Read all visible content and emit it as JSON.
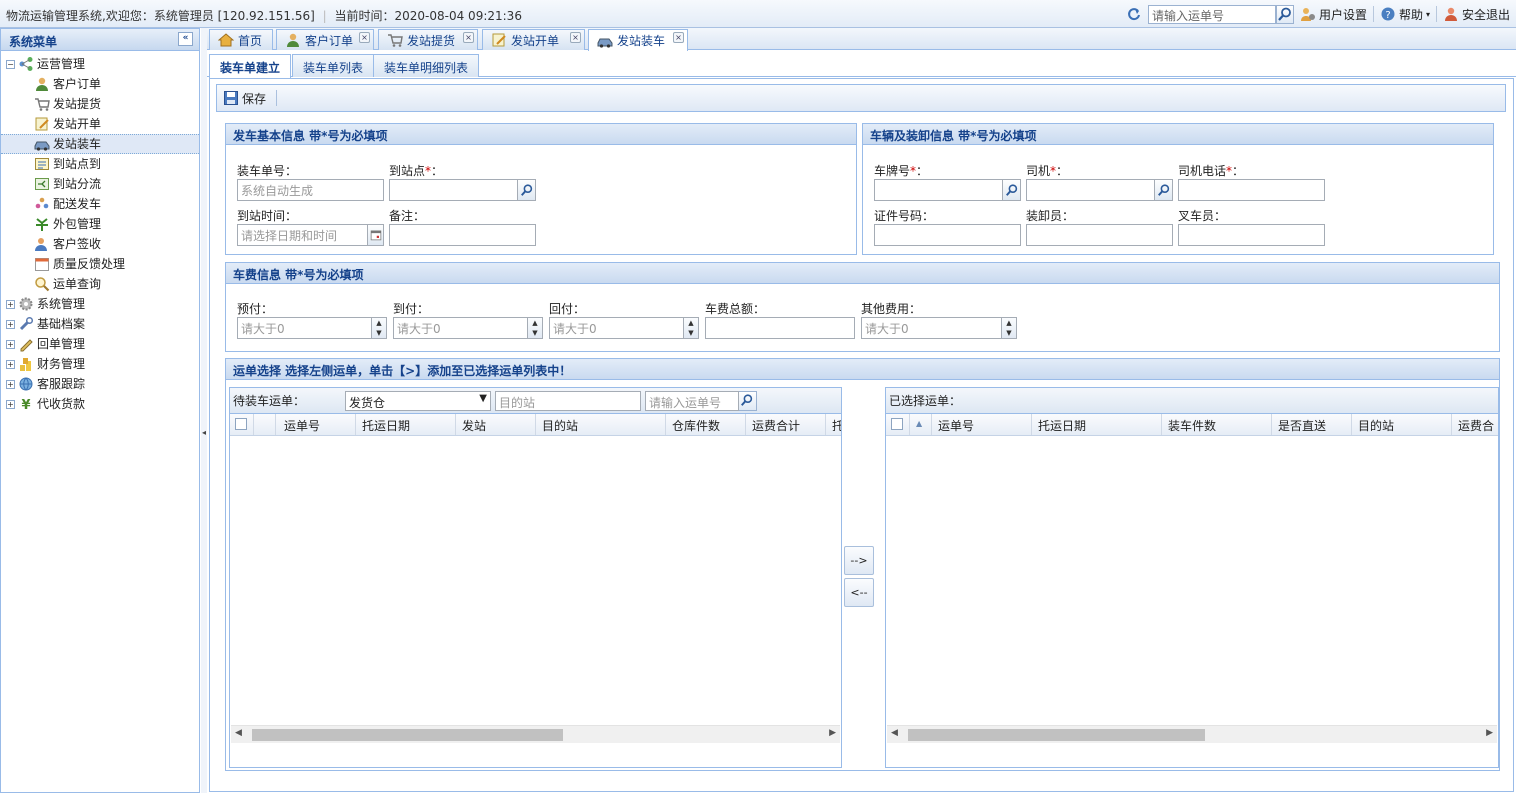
{
  "topbar": {
    "system_info": "物流运输管理系统,欢迎您：系统管理员 [120.92.151.56]",
    "time_label": "当前时间：2020-08-04 09:21:36",
    "search_placeholder": "请输入运单号",
    "user_settings": "用户设置",
    "help": "帮助",
    "logout": "安全退出"
  },
  "sidebar": {
    "title": "系统菜单",
    "groups": [
      {
        "label": "运营管理",
        "expanded": true
      },
      {
        "label": "系统管理"
      },
      {
        "label": "基础档案"
      },
      {
        "label": "回单管理"
      },
      {
        "label": "财务管理"
      },
      {
        "label": "客服跟踪"
      },
      {
        "label": "代收货款"
      }
    ],
    "items": [
      {
        "label": "客户订单",
        "icon": "user-icon"
      },
      {
        "label": "发站提货",
        "icon": "cart-icon"
      },
      {
        "label": "发站开单",
        "icon": "form-icon"
      },
      {
        "label": "发站装车",
        "icon": "car-icon",
        "selected": true
      },
      {
        "label": "到站点到",
        "icon": "checklist-icon"
      },
      {
        "label": "到站分流",
        "icon": "split-icon"
      },
      {
        "label": "配送发车",
        "icon": "people-icon"
      },
      {
        "label": "外包管理",
        "icon": "leaf-icon"
      },
      {
        "label": "客户签收",
        "icon": "sign-icon"
      },
      {
        "label": "质量反馈处理",
        "icon": "calendar-icon"
      },
      {
        "label": "运单查询",
        "icon": "magnifier-icon"
      }
    ]
  },
  "tabs": [
    {
      "label": "首页"
    },
    {
      "label": "客户订单"
    },
    {
      "label": "发站提货"
    },
    {
      "label": "发站开单"
    },
    {
      "label": "发站装车",
      "active": true
    }
  ],
  "subtabs": [
    {
      "label": "装车单建立",
      "active": true
    },
    {
      "label": "装车单列表"
    },
    {
      "label": "装车单明细列表"
    }
  ],
  "toolbar": {
    "save_label": "保存"
  },
  "basic_panel": {
    "title": "发车基本信息 带*号为必填项",
    "load_no_label": "装车单号：",
    "load_no_placeholder": "系统自动生成",
    "dest_label": "到站点",
    "arrive_time_label": "到站时间：",
    "arrive_time_placeholder": "请选择日期和时间",
    "remark_label": "备注："
  },
  "vehicle_panel": {
    "title": "车辆及装卸信息 带*号为必填项",
    "plate_label": "车牌号",
    "driver_label": "司机",
    "driver_phone_label": "司机电话",
    "cert_label": "证件号码：",
    "loader_label": "装卸员：",
    "forklift_label": "叉车员："
  },
  "fee_panel": {
    "title": "车费信息 带*号为必填项",
    "prepay_label": "预付：",
    "arrive_pay_label": "到付：",
    "return_pay_label": "回付：",
    "total_label": "车费总额：",
    "other_label": "其他费用：",
    "num_placeholder": "请大于0"
  },
  "waybill_panel": {
    "title": "运单选择 选择左侧运单，单击【>】添加至已选择运单列表中！",
    "left": {
      "title": "待装车运单：",
      "select_value": "发货仓",
      "dest_placeholder": "目的站",
      "search_placeholder": "请输入运单号",
      "columns": [
        "运单号",
        "托运日期",
        "发站",
        "目的站",
        "仓库件数",
        "运费合计",
        "托"
      ]
    },
    "right": {
      "title": "已选择运单：",
      "columns": [
        "运单号",
        "托运日期",
        "装车件数",
        "是否直送",
        "目的站",
        "运费合"
      ]
    },
    "move_right": "-->",
    "move_left": "<--"
  }
}
